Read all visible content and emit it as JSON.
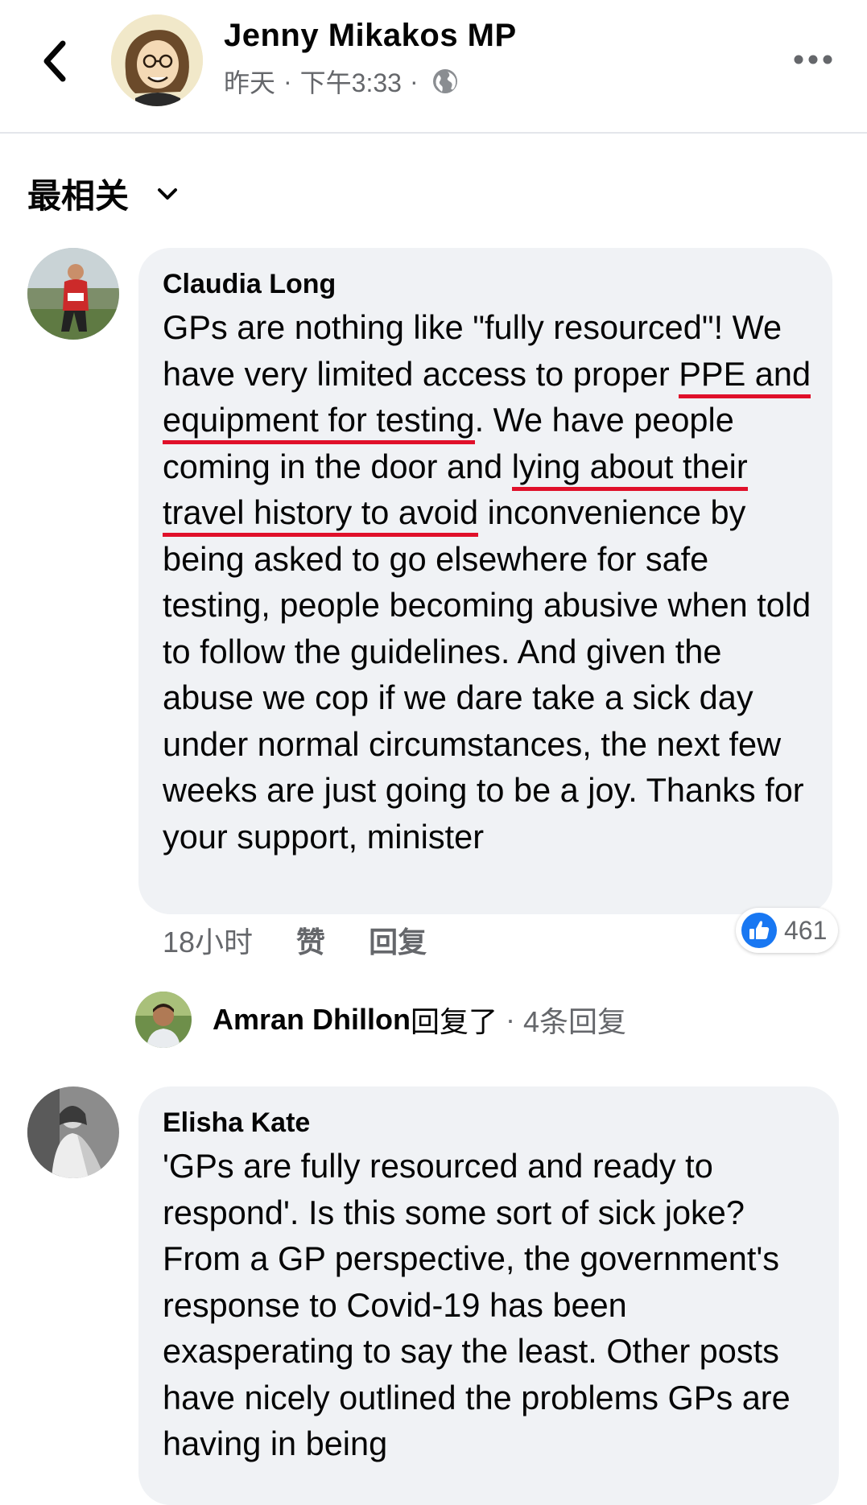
{
  "header": {
    "back_icon": "chevron-left-icon",
    "page_name": "Jenny Mikakos MP",
    "post_day": "昨天",
    "post_time": "下午3:33",
    "separator": "·",
    "privacy_icon": "globe-icon",
    "more_icon": "more-horizontal-icon"
  },
  "sort": {
    "label": "最相关",
    "icon": "chevron-down-icon"
  },
  "comments": [
    {
      "author": "Claudia Long",
      "text_parts": [
        "GPs are nothing like \"fully resourced\"! We have very limited access to proper ",
        "PPE and equipment for testing",
        ". We have people coming in the door and ",
        "lying about their travel history to avoid",
        " inconvenience by being asked to go elsewhere for safe testing, people becoming abusive when told to follow the guidelines. And given the abuse we cop if we dare take a sick day under normal circumstances, the next few weeks are just going to be a joy. Thanks for your support, minister"
      ],
      "time": "18小时",
      "like_label": "赞",
      "reply_label": "回复",
      "reaction_icon": "thumbs-up-icon",
      "reaction_count": "461",
      "reply_summary": {
        "name": "Amran Dhillon",
        "verb": "回复了",
        "separator": " · ",
        "count": "4条回复"
      }
    },
    {
      "author": "Elisha Kate",
      "text": "'GPs are fully resourced and ready to respond'. Is this some sort of sick joke? From a GP perspective, the government's response to Covid-19 has been exasperating to say the least. Other posts have nicely outlined the problems GPs are having in being"
    }
  ],
  "colors": {
    "highlight_underline": "#e0102a",
    "like_blue": "#1877f2",
    "bubble_bg": "#f0f2f5",
    "secondary_text": "#65676b"
  }
}
